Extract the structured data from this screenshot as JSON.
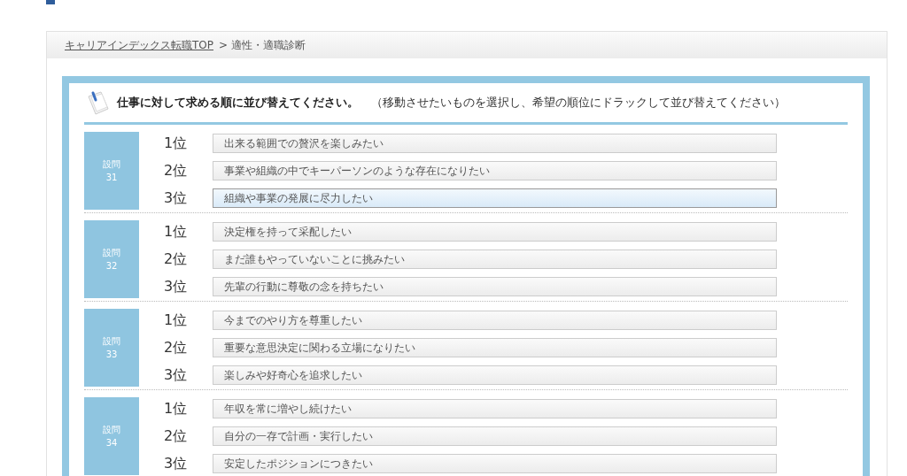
{
  "breadcrumb": {
    "link": "キャリアインデックス転職TOP",
    "current": "> 適性・適職診断"
  },
  "instruction": {
    "title": "仕事に対して求める順に並び替えてください。",
    "note": "（移動させたいものを選択し、希望の順位にドラックして並び替えてください）"
  },
  "questions": [
    {
      "label": "設問",
      "number": "31",
      "items": [
        {
          "rank": "1位",
          "text": "出来る範囲での贅沢を楽しみたい",
          "selected": false
        },
        {
          "rank": "2位",
          "text": "事業や組織の中でキーパーソンのような存在になりたい",
          "selected": false
        },
        {
          "rank": "3位",
          "text": "組織や事業の発展に尽力したい",
          "selected": true
        }
      ]
    },
    {
      "label": "設問",
      "number": "32",
      "items": [
        {
          "rank": "1位",
          "text": "決定権を持って采配したい",
          "selected": false
        },
        {
          "rank": "2位",
          "text": "まだ誰もやっていないことに挑みたい",
          "selected": false
        },
        {
          "rank": "3位",
          "text": "先輩の行動に尊敬の念を持ちたい",
          "selected": false
        }
      ]
    },
    {
      "label": "設問",
      "number": "33",
      "items": [
        {
          "rank": "1位",
          "text": "今までのやり方を尊重したい",
          "selected": false
        },
        {
          "rank": "2位",
          "text": "重要な意思決定に関わる立場になりたい",
          "selected": false
        },
        {
          "rank": "3位",
          "text": "楽しみや好奇心を追求したい",
          "selected": false
        }
      ]
    },
    {
      "label": "設問",
      "number": "34",
      "items": [
        {
          "rank": "1位",
          "text": "年収を常に増やし続けたい",
          "selected": false
        },
        {
          "rank": "2位",
          "text": "自分の一存で計画・実行したい",
          "selected": false
        },
        {
          "rank": "3位",
          "text": "安定したポジションにつきたい",
          "selected": false
        }
      ]
    }
  ]
}
